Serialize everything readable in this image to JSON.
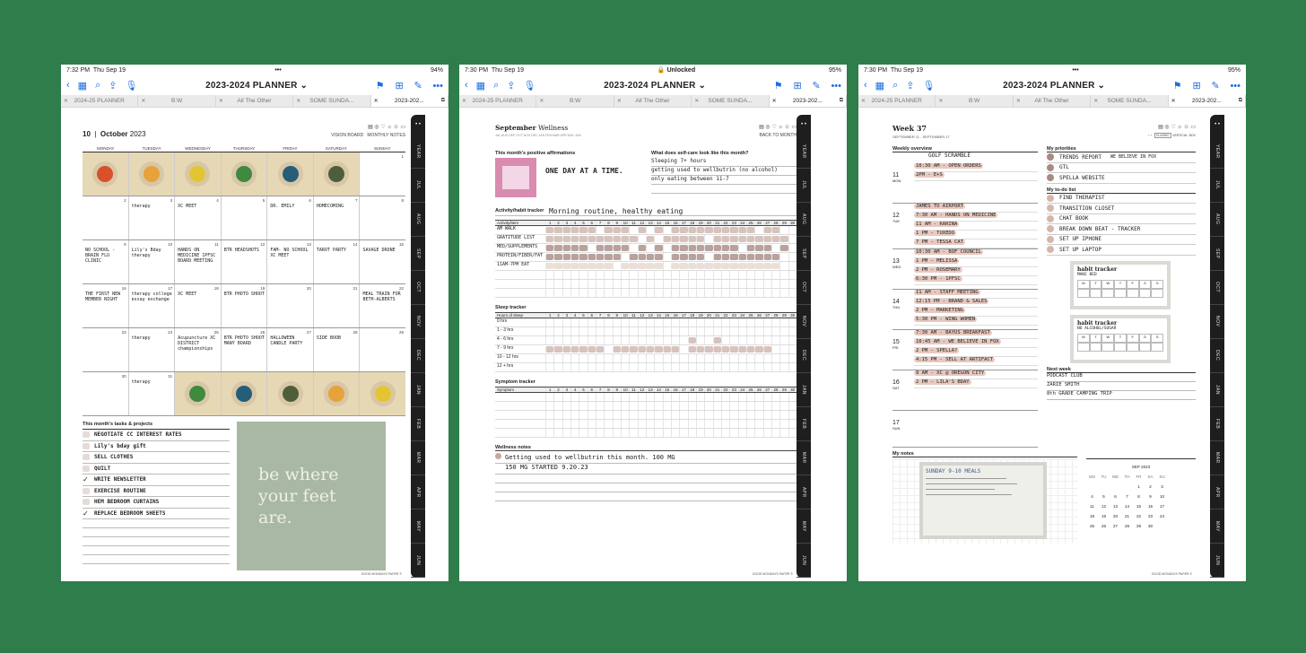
{
  "screens": [
    {
      "status": {
        "time": "7:32 PM",
        "date": "Thu Sep 19",
        "center": "•••",
        "battery": "94%"
      },
      "toolbar": {
        "title": "2023-2024 PLANNER ⌄"
      },
      "tabs": [
        "2024-25 PLANNER",
        "B:W",
        "All The Other",
        "SOME SUNDA...",
        "2023-202..."
      ],
      "page": {
        "month_num": "10",
        "month_name": "October",
        "year": "2023",
        "links": [
          "VISION BOARD",
          "MONTHLY NOTES"
        ],
        "weekdays": [
          "MONDAY",
          "TUESDAY",
          "WEDNESDAY",
          "THURSDAY",
          "FRIDAY",
          "SATURDAY",
          "SUNDAY"
        ],
        "rows": [
          [
            {
              "n": "",
              "t": ""
            },
            {
              "n": "",
              "t": ""
            },
            {
              "n": "",
              "t": ""
            },
            {
              "n": "",
              "t": ""
            },
            {
              "n": "",
              "t": ""
            },
            {
              "n": "",
              "t": ""
            },
            {
              "n": "1",
              "t": ""
            }
          ],
          [
            {
              "n": "2",
              "t": ""
            },
            {
              "n": "3",
              "t": "therapy"
            },
            {
              "n": "4",
              "t": "XC MEET"
            },
            {
              "n": "5",
              "t": ""
            },
            {
              "n": "6",
              "t": "DR. EMILY"
            },
            {
              "n": "7",
              "t": "HOMECOMING"
            },
            {
              "n": "8",
              "t": ""
            }
          ],
          [
            {
              "n": "9",
              "t": "NO SCHOOL - BRAIN FLU CLINIC"
            },
            {
              "n": "10",
              "t": "Lily's Bday therapy"
            },
            {
              "n": "11",
              "t": "HANDS ON MEDICINE 1PFSC BOARD MEETING"
            },
            {
              "n": "12",
              "t": "BTR HEADSHOTS"
            },
            {
              "n": "13",
              "t": "FAM- NO SCHOOL XC MEET"
            },
            {
              "n": "14",
              "t": "TAROT PARTY"
            },
            {
              "n": "15",
              "t": "SAVAGE DRONE"
            }
          ],
          [
            {
              "n": "16",
              "t": "THE FIRST NEW MEMBER NIGHT"
            },
            {
              "n": "17",
              "t": "therapy college essay exchange"
            },
            {
              "n": "18",
              "t": "XC MEET"
            },
            {
              "n": "19",
              "t": "BTR PHOTO SHOOT"
            },
            {
              "n": "20",
              "t": ""
            },
            {
              "n": "21",
              "t": ""
            },
            {
              "n": "22",
              "t": "MEAL TRAIN FOR BETH-ALBERTS"
            }
          ],
          [
            {
              "n": "23",
              "t": ""
            },
            {
              "n": "24",
              "t": "therapy"
            },
            {
              "n": "25",
              "t": "Acupuncture XC DISTRICT championships"
            },
            {
              "n": "26",
              "t": "BTR PHOTO SHOOT MANY BOARD"
            },
            {
              "n": "27",
              "t": "HALLOWEEN CANDLE PARTY"
            },
            {
              "n": "28",
              "t": "SIDE BOOB"
            },
            {
              "n": "29",
              "t": ""
            }
          ],
          [
            {
              "n": "30",
              "t": ""
            },
            {
              "n": "31",
              "t": "therapy"
            },
            {
              "n": "",
              "t": ""
            },
            {
              "n": "",
              "t": ""
            },
            {
              "n": "",
              "t": ""
            },
            {
              "n": "",
              "t": ""
            },
            {
              "n": "",
              "t": ""
            }
          ]
        ],
        "tasks_title": "This month's tasks & projects",
        "tasks": [
          {
            "text": "NEGOTIATE CC INTEREST RATES",
            "done": false
          },
          {
            "text": "Lily's bday gift",
            "done": false
          },
          {
            "text": "SELL CLOTHES",
            "done": false
          },
          {
            "text": "QUILT",
            "done": false
          },
          {
            "text": "WRITE NEWSLETTER",
            "done": true
          },
          {
            "text": "EXERCISE ROUTINE",
            "done": false
          },
          {
            "text": "HEM BEDROOM CURTAINS",
            "done": false
          },
          {
            "text": "REPLACE BEDROOM SHEETS",
            "done": true
          }
        ],
        "poster_text": "be where your feet are.",
        "footer": "GOOD MONDAYS PAPER ©"
      }
    },
    {
      "status": {
        "time": "7:30 PM",
        "date": "Thu Sep 19",
        "center": "🔒 Unlocked",
        "battery": "95%"
      },
      "toolbar": {
        "title": "2023-2024 PLANNER ⌄"
      },
      "tabs": [
        "2024-25 PLANNER",
        "B:W",
        "All The Other",
        "SOME SUNDA...",
        "2023-202..."
      ],
      "page": {
        "title_bold": "September",
        "title_rest": "Wellness",
        "months": "JUL AUG SEP OCT NOV DEC JAN FEB MAR APR MAY JUN",
        "back": "BACK TO MONTH",
        "affirm_title": "This month's positive affirmations",
        "affirmation": "ONE DAY AT A TIME.",
        "selfcare_title": "What does self-care look like this month?",
        "selfcare": [
          "Sleeping 7+ hours",
          "getting used to wellbutrin (no alcohol)",
          "only eating between 11-7"
        ],
        "habit_title": "Activity/habit tracker",
        "habit_note": "Morning routine, healthy eating",
        "habit_col": "Activity/item",
        "habits": [
          "AM WALK",
          "GRATITUDE LIST",
          "MED/SUPPLEMENTS",
          "PROTEIN/FIBER/FAT",
          "11AM-7PM EAT"
        ],
        "sleep_title": "Sleep tracker",
        "sleep_col": "Hours of sleep",
        "sleep_rows": [
          "0 hrs",
          "1 - 3 hrs",
          "4 - 6 hrs",
          "7 - 9 hrs",
          "10 - 12 hrs",
          "12 + hrs"
        ],
        "symptom_title": "Symptom tracker",
        "symptom_col": "Symptom",
        "notes_title": "Wellness notes",
        "notes": [
          "Getting used to wellbutrin this month. 100 MG",
          "150 MG STARTED 9.20.23"
        ],
        "footer": "GOOD MONDAYS PAPER ©"
      }
    },
    {
      "status": {
        "time": "7:30 PM",
        "date": "Thu Sep 19",
        "center": "•••",
        "battery": "95%"
      },
      "toolbar": {
        "title": "2023-2024 PLANNER ⌄"
      },
      "tabs": [
        "2024-25 PLANNER",
        "B:W",
        "All The Other",
        "SOME SUNDA...",
        "2023-202..."
      ],
      "page": {
        "week": "Week 37",
        "range": "SEPTEMBER 11 - SEPTEMBER 17",
        "views": [
          "CLASSIC",
          "VERTICAL",
          "BOX"
        ],
        "overview_title": "Weekly overview",
        "top_note": "GOLF SCRAMBLE",
        "days": [
          {
            "n": "11",
            "d": "MON",
            "items": [
              "10:30 AM - OPEN ORDERS",
              "2PM - E+S"
            ]
          },
          {
            "n": "12",
            "d": "TUE",
            "items": [
              "JAMES TO AIRPORT",
              "7:30 AM - HANDS ON MEDICINE",
              "11 AM - KARINA",
              "1 PM - TUXEDO",
              "7 PM - TESSA CAT"
            ]
          },
          {
            "n": "13",
            "d": "WED",
            "items": [
              "10:30 AM - BOF COUNCIL",
              "1 PM - MELISSA",
              "2 PM - ROSEMARY",
              "6:30 PM - 1PFSC"
            ]
          },
          {
            "n": "14",
            "d": "THU",
            "items": [
              "11 AM - STAFF MEETING",
              "12:15 PM - BRAND & SALES",
              "2 PM - MARKETING",
              "5:30 PM - WING WOMEN"
            ]
          },
          {
            "n": "15",
            "d": "FRI",
            "items": [
              "7:30 AM - BAYUS BREAKFAST",
              "10:45 AM - WE BELIEVE IN FOX",
              "2 PM - SPELLA?",
              "4:15 PM - SELL AT ARTIFACT"
            ]
          },
          {
            "n": "16",
            "d": "SAT",
            "items": [
              "9 AM - XC @ OREGON CITY",
              "2 PM - LILA'S BDAY"
            ]
          },
          {
            "n": "17",
            "d": "SUN",
            "items": []
          }
        ],
        "priorities_title": "My priorities",
        "priorities": [
          "TRENDS REPORT",
          "GTL",
          "SPELLA WEBSITE"
        ],
        "priority_extra": "WE BELIEVE IN FOX",
        "todo_title": "My to-do list",
        "todos": [
          "FIND THERAPIST",
          "TRANSITION CLOSET",
          "CHAT BOOK",
          "BREAK DOWN BEAT - TRACKER",
          "SET UP IPHONE",
          "SET UP LAPTOP"
        ],
        "habit_cards": [
          {
            "title": "habit tracker",
            "habit": "MAKE BED",
            "days": [
              "M",
              "T",
              "W",
              "T",
              "F",
              "S",
              "S"
            ]
          },
          {
            "title": "habit tracker",
            "habit": "NO ALCOHOL/SUGAR",
            "days": [
              "M",
              "T",
              "W",
              "T",
              "F",
              "S",
              "S"
            ]
          }
        ],
        "next_title": "Next week",
        "next": [
          "PODCAST CLUB",
          "ZARIE SMITH",
          "8th GRADE CAMPING TRIP"
        ],
        "notes_title": "My notes",
        "note_heading": "SUNDAY 9-10 MEALS",
        "minical_title": "SEP 2023",
        "minical_days": [
          "MO",
          "TU",
          "WE",
          "TH",
          "FR",
          "SA",
          "SU"
        ],
        "minical_weeks": [
          [
            "",
            "",
            "",
            "",
            "1",
            "2",
            "3"
          ],
          [
            "4",
            "5",
            "6",
            "7",
            "8",
            "9",
            "10"
          ],
          [
            "11",
            "12",
            "13",
            "14",
            "15",
            "16",
            "17"
          ],
          [
            "18",
            "19",
            "20",
            "21",
            "22",
            "23",
            "24"
          ],
          [
            "25",
            "26",
            "27",
            "28",
            "29",
            "30",
            ""
          ]
        ],
        "footer": "GOOD MONDAYS PAPER ©"
      }
    }
  ],
  "side_tabs": [
    "YEAR",
    "JUL",
    "AUG",
    "SEP",
    "OCT",
    "NOV",
    "DEC",
    "JAN",
    "FEB",
    "MAR",
    "APR",
    "MAY",
    "JUN"
  ],
  "colors": {
    "background": "#2e7d4a",
    "accent": "#1a6fe0",
    "highlight": "#e9c9bf"
  }
}
